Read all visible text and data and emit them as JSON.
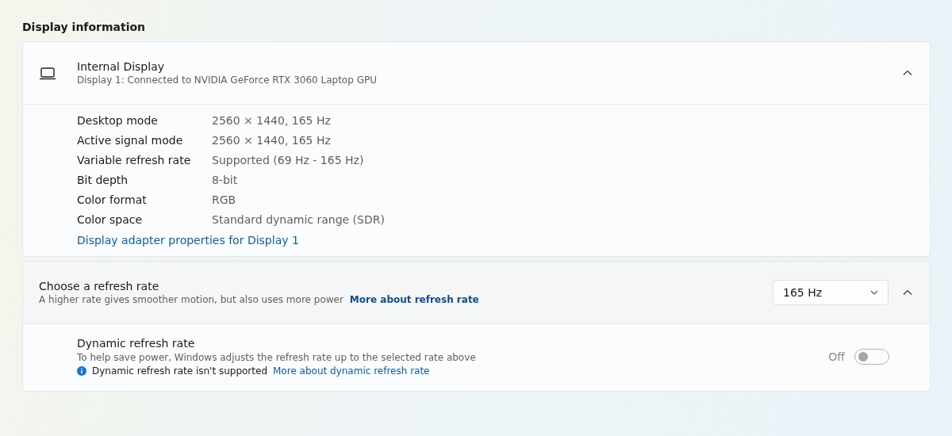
{
  "section_title": "Display information",
  "display": {
    "name": "Internal Display",
    "subtitle": "Display 1: Connected to NVIDIA GeForce RTX 3060 Laptop GPU",
    "expanded": true,
    "properties": [
      {
        "label": "Desktop mode",
        "value": "2560 × 1440, 165 Hz"
      },
      {
        "label": "Active signal mode",
        "value": "2560 × 1440, 165 Hz"
      },
      {
        "label": "Variable refresh rate",
        "value": "Supported (69 Hz - 165 Hz)"
      },
      {
        "label": "Bit depth",
        "value": "8-bit"
      },
      {
        "label": "Color format",
        "value": "RGB"
      },
      {
        "label": "Color space",
        "value": "Standard dynamic range (SDR)"
      }
    ],
    "link": "Display adapter properties for Display 1"
  },
  "refresh_rate": {
    "title": "Choose a refresh rate",
    "description": "A higher rate gives smoother motion, but also uses more power",
    "link": "More about refresh rate",
    "dropdown_value": "165 Hz",
    "expanded": true,
    "dynamic": {
      "title": "Dynamic refresh rate",
      "description": "To help save power, Windows adjusts the refresh rate up to the selected rate above",
      "notice": "Dynamic refresh rate isn't supported",
      "notice_link": "More about dynamic refresh rate",
      "toggle_label": "Off",
      "on": false,
      "disabled": true
    }
  }
}
